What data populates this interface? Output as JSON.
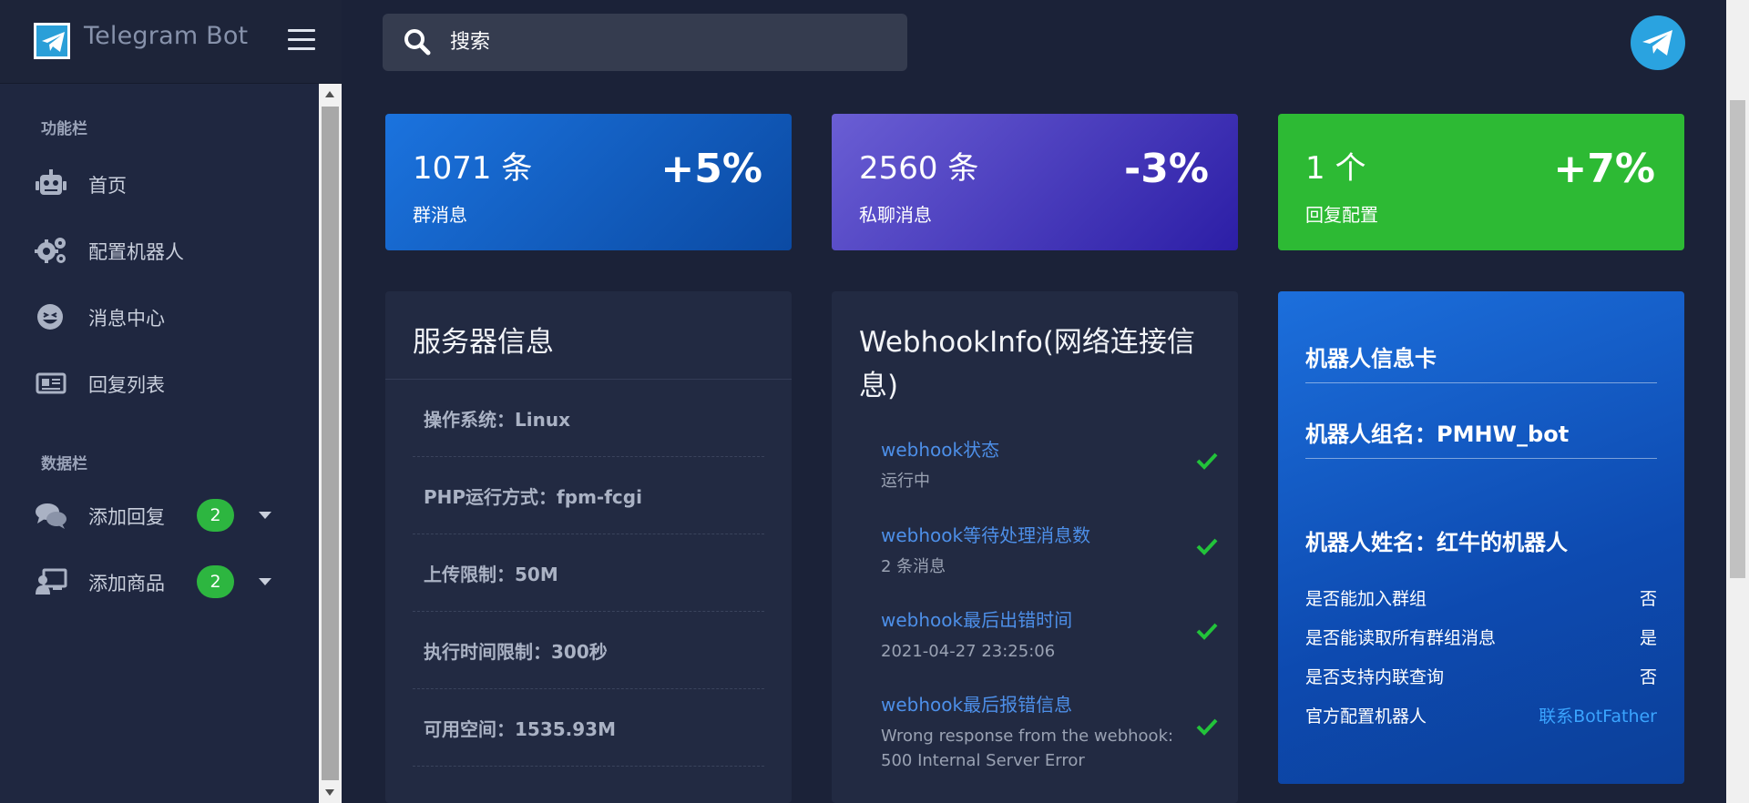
{
  "sidebar": {
    "brand": "Telegram Bot",
    "section_function": "功能栏",
    "section_data": "数据栏",
    "items": [
      {
        "label": "首页",
        "icon": "robot-icon"
      },
      {
        "label": "配置机器人",
        "icon": "gears-icon"
      },
      {
        "label": "消息中心",
        "icon": "emoji-icon"
      },
      {
        "label": "回复列表",
        "icon": "newspaper-icon"
      }
    ],
    "data_items": [
      {
        "label": "添加回复",
        "badge": "2",
        "icon": "comments-icon"
      },
      {
        "label": "添加商品",
        "badge": "2",
        "icon": "user-board-icon"
      }
    ]
  },
  "header": {
    "search_placeholder": "搜索"
  },
  "stats": [
    {
      "value": "1071 条",
      "label": "群消息",
      "delta": "+5%",
      "color": "#1b73de"
    },
    {
      "value": "2560 条",
      "label": "私聊消息",
      "delta": "-3%",
      "color": "#5a4ecc"
    },
    {
      "value": "1 个",
      "label": "回复配置",
      "delta": "+7%",
      "color": "#2dba34"
    }
  ],
  "server": {
    "title": "服务器信息",
    "rows": [
      "操作系统：Linux",
      "PHP运行方式：fpm-fcgi",
      "上传限制：50M",
      "执行时间限制：300秒",
      "可用空间：1535.93M"
    ]
  },
  "webhook": {
    "title_line1": "WebhookInfo(网络连接信",
    "title_line2": "息)",
    "items": [
      {
        "title": "webhook状态",
        "desc": "运行中"
      },
      {
        "title": "webhook等待处理消息数",
        "desc": "2 条消息"
      },
      {
        "title": "webhook最后出错时间",
        "desc": "2021-04-27 23:25:06"
      },
      {
        "title": "webhook最后报错信息",
        "desc_line1": "Wrong response from the webhook:",
        "desc_line2": "500 Internal Server Error"
      }
    ]
  },
  "bot": {
    "card_title": "机器人信息卡",
    "group_name": "机器人组名：PMHW_bot",
    "bot_name": "机器人姓名：红牛的机器人",
    "rows": [
      {
        "key": "是否能加入群组",
        "value": "否"
      },
      {
        "key": "是否能读取所有群组消息",
        "value": "是"
      },
      {
        "key": "是否支持内联查询",
        "value": "否"
      },
      {
        "key": "官方配置机器人",
        "value": "联系BotFather"
      }
    ]
  },
  "colors": {
    "background": "#1b2238",
    "panel": "#222a42",
    "accent_link": "#4d8fe8",
    "success": "#2db640"
  }
}
